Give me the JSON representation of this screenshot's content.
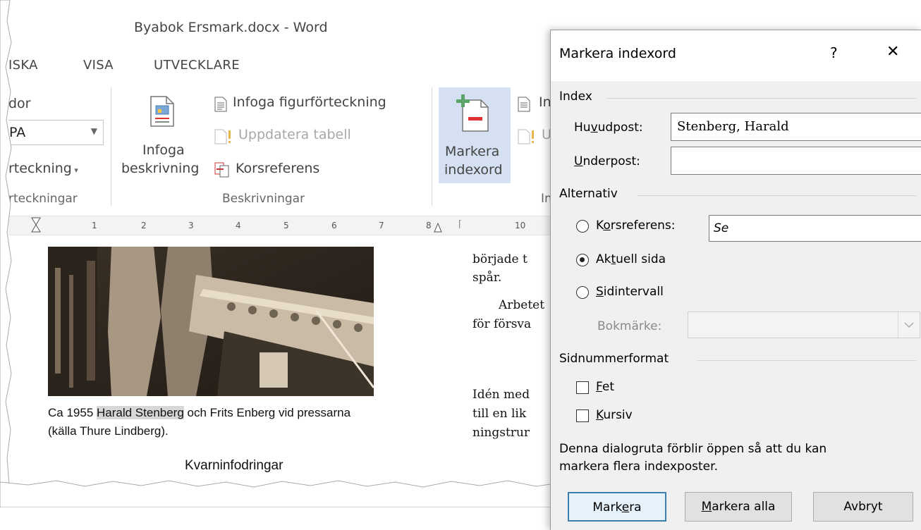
{
  "window": {
    "title": "Byabok Ersmark.docx - Word"
  },
  "menu": {
    "items": [
      "ISKA",
      "VISA",
      "UTVECKLARE"
    ]
  },
  "ribbon": {
    "left_group": {
      "item1": "dor",
      "dropdown_value": "PA",
      "item3": "rteckning",
      "label": "rteckningar"
    },
    "beskrivningar": {
      "infoga_beskrivning_line1": "Infoga",
      "infoga_beskrivning_line2": "beskrivning",
      "infoga_figurforteckning": "Infoga figurförteckning",
      "uppdatera_tabell": "Uppdatera tabell",
      "korsreferens": "Korsreferens",
      "label": "Beskrivningar"
    },
    "index_group": {
      "markera_line1": "Markera",
      "markera_line2": "indexord",
      "item_in": "In",
      "item_u": "U",
      "label": "In"
    }
  },
  "ruler": {
    "numbers": [
      "1",
      "2",
      "3",
      "4",
      "5",
      "6",
      "7",
      "8",
      "10"
    ]
  },
  "document": {
    "caption_pre": "Ca 1955 ",
    "caption_highlight": "Harald Stenberg",
    "caption_post": " och Frits Enberg vid pressarna",
    "caption_line2": "(källa Thure Lindberg).",
    "heading": "Kvarninfodringar",
    "right_col": [
      "började t",
      "spår.",
      "Arbetet",
      "för försva",
      "Idén med",
      "till en lik",
      "ningstrur"
    ]
  },
  "dialog": {
    "title": "Markera indexord",
    "help": "?",
    "close": "✕",
    "section_index": "Index",
    "huvudpost_label": "Huvudpost:",
    "huvudpost_value": "Stenberg, Harald",
    "underpost_label": "Underpost:",
    "underpost_value": "",
    "section_alternativ": "Alternativ",
    "korsreferens_label": "Korsreferens:",
    "korsreferens_value": "Se",
    "aktuell_sida_label": "Aktuell sida",
    "sidintervall_label": "Sidintervall",
    "bokmarke_label": "Bokmärke:",
    "section_sidnummerformat": "Sidnummerformat",
    "fet_label": "Fet",
    "kursiv_label": "Kursiv",
    "info_line1": "Denna dialogruta förblir öppen så att du kan",
    "info_line2": "markera flera indexposter.",
    "btn_markera": "Markera",
    "btn_markera_alla": "Markera alla",
    "btn_avbryt": "Avbryt"
  }
}
